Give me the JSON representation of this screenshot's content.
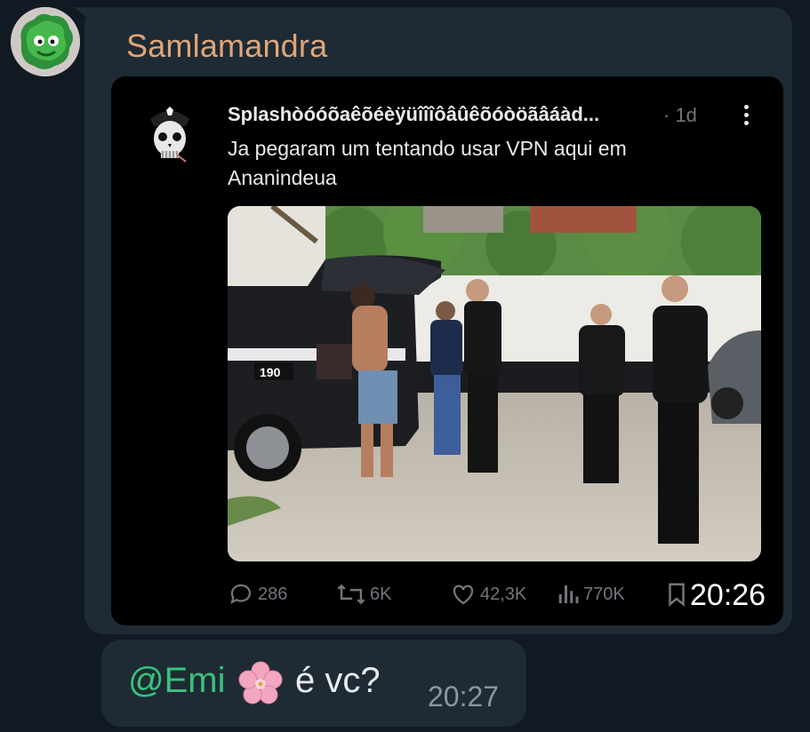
{
  "message1": {
    "sender": "Samlamandra",
    "time": "20:26"
  },
  "tweet": {
    "author": "Splashòóóõaêõéèÿüîîîôâûêõóòöãâáàd...",
    "age": "· 1d",
    "text": "Ja pegaram um tentando usar VPN aqui em Ananindeua",
    "photo_labels": {
      "car_plate": "190"
    },
    "stats": {
      "replies": "286",
      "retweets": "6K",
      "likes": "42,3K",
      "views": "770K"
    },
    "icons": [
      "reply-icon",
      "retweet-icon",
      "heart-icon",
      "views-icon",
      "bookmark-icon",
      "more-vertical-icon"
    ]
  },
  "message2": {
    "mention": "@Emi",
    "emoji": "🌸",
    "text": "é vc?",
    "time": "20:27"
  },
  "colors": {
    "background": "#111a22",
    "bubble": "#1e2b34",
    "sender_name": "#e0a578",
    "mention": "#39c37a",
    "tweet_bg": "#000000",
    "muted": "#71767b"
  }
}
